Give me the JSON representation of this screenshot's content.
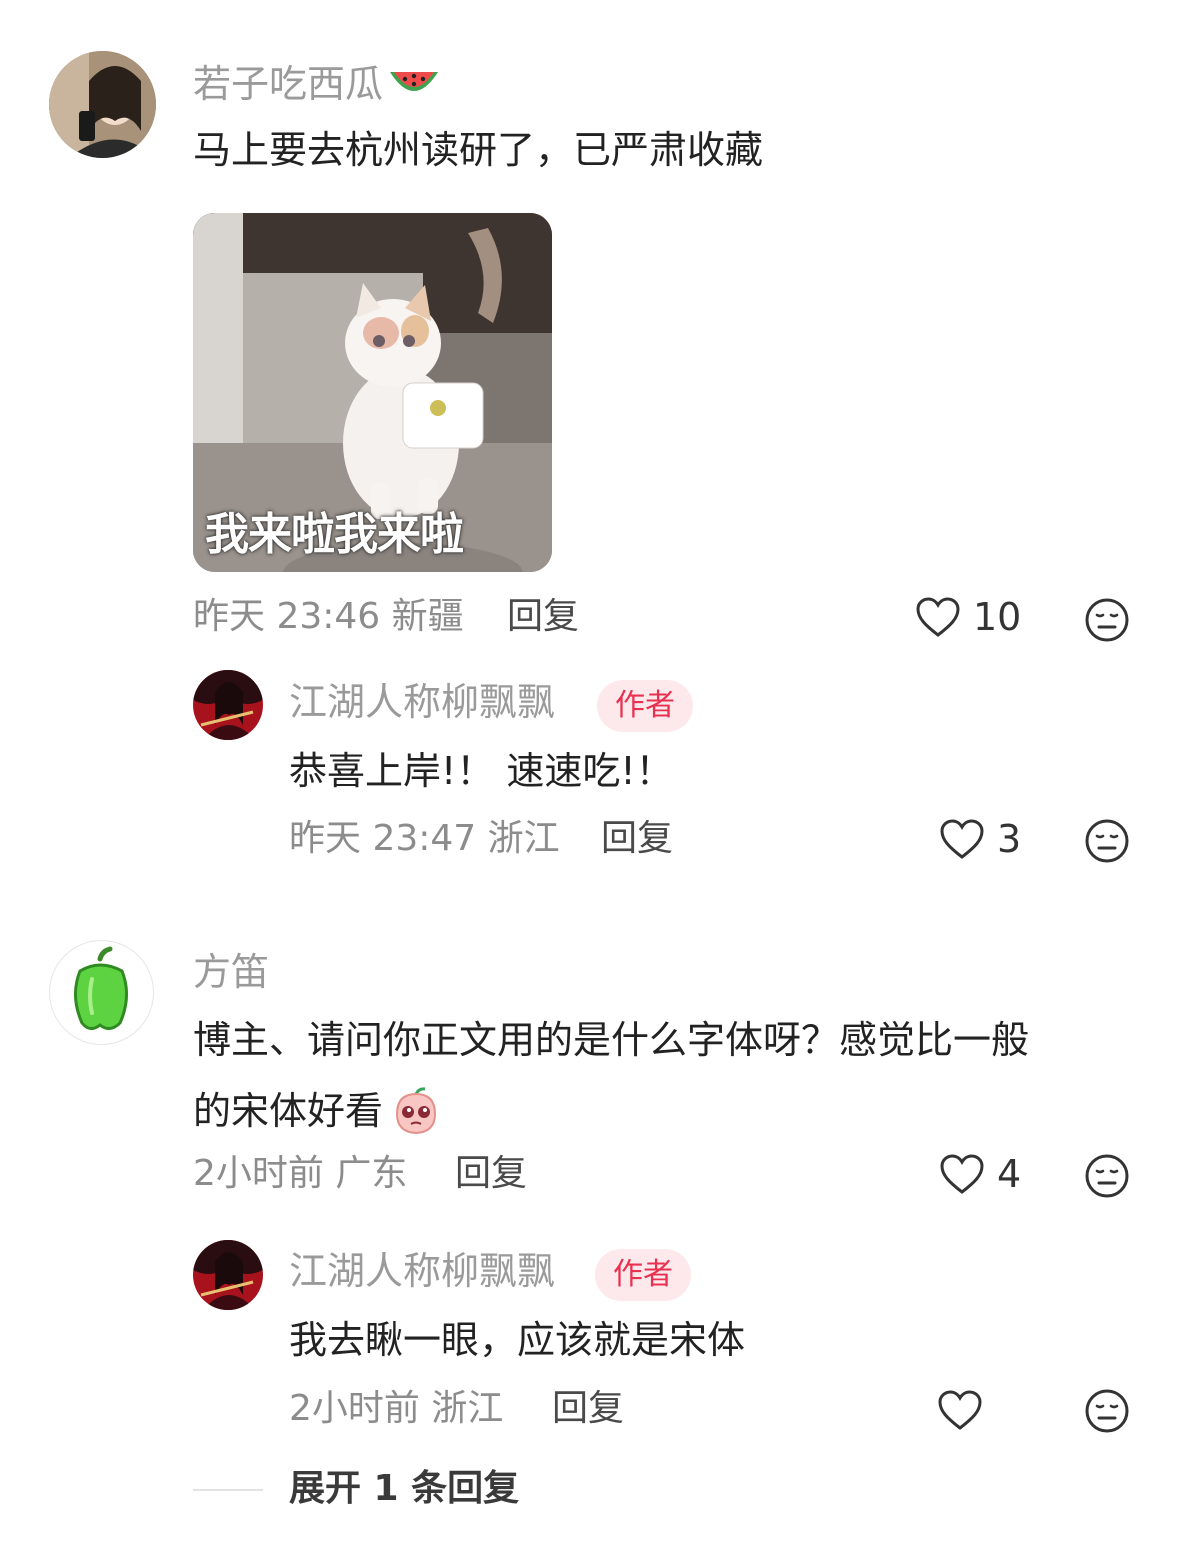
{
  "comments": [
    {
      "user": "若子吃西瓜",
      "name_emoji": "watermelon-emoji",
      "text": "马上要去杭州读研了，已严肃收藏",
      "sticker": {
        "caption": "我来啦我来啦"
      },
      "time": "昨天 23:46",
      "location": "新疆",
      "reply_label": "回复",
      "likes": "10",
      "reply": {
        "user": "江湖人称柳飘飘",
        "badge": "作者",
        "text": "恭喜上岸!！ 速速吃!！",
        "time": "昨天 23:47",
        "location": "浙江",
        "reply_label": "回复",
        "likes": "3"
      }
    },
    {
      "user": "方笛",
      "text_line1": "博主、请问你正文用的是什么字体呀？感觉比一般",
      "text_line2": "的宋体好看",
      "text_emoji": "pleading-peach-emoji",
      "time": "2小时前",
      "location": "广东",
      "reply_label": "回复",
      "likes": "4",
      "reply": {
        "user": "江湖人称柳飘飘",
        "badge": "作者",
        "text": "我去瞅一眼，应该就是宋体",
        "time": "2小时前",
        "location": "浙江",
        "reply_label": "回复",
        "likes": ""
      }
    }
  ],
  "expand_replies": "展开 1 条回复",
  "colors": {
    "author_badge_bg": "#fde8ec",
    "author_badge_text": "#e8314f",
    "name": "#9a9a9a"
  }
}
